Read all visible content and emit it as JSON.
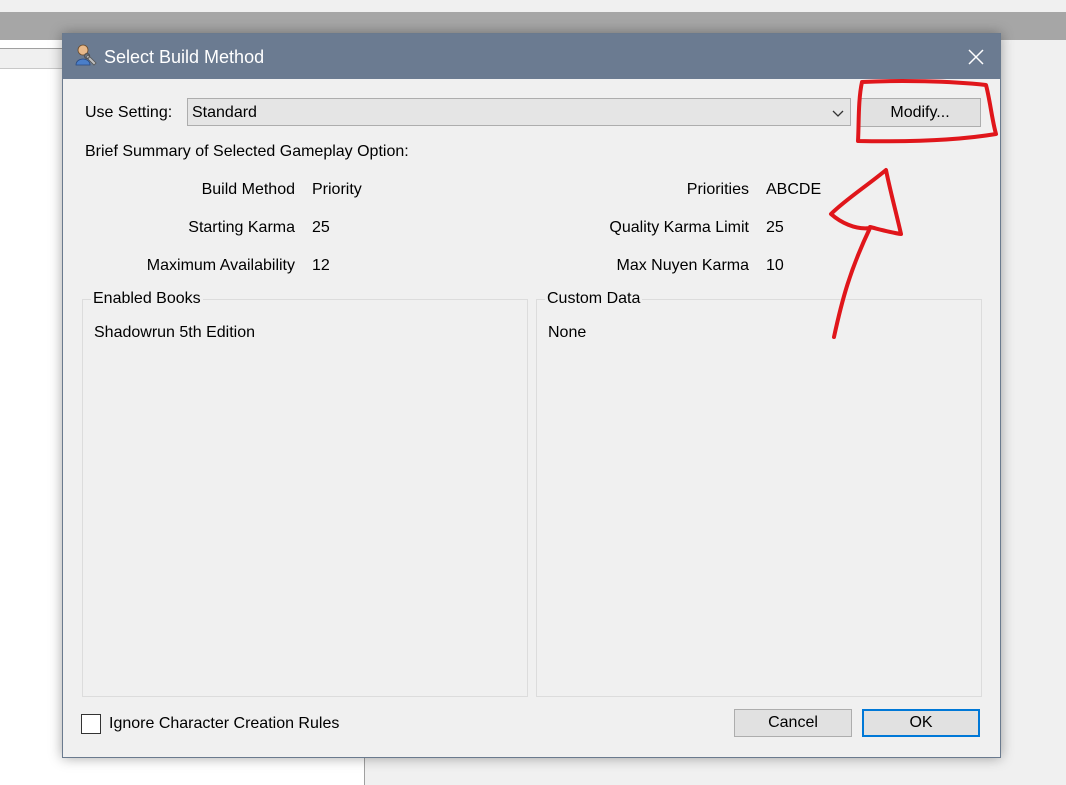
{
  "dialog": {
    "title": "Select Build Method",
    "use_setting_label": "Use Setting:",
    "use_setting_value": "Standard",
    "modify_label": "Modify...",
    "summary_label": "Brief Summary of Selected Gameplay Option:"
  },
  "summary": {
    "left": [
      {
        "label": "Build Method",
        "value": "Priority"
      },
      {
        "label": "Starting Karma",
        "value": "25"
      },
      {
        "label": "Maximum Availability",
        "value": "12"
      }
    ],
    "right": [
      {
        "label": "Priorities",
        "value": "ABCDE"
      },
      {
        "label": "Quality Karma Limit",
        "value": "25"
      },
      {
        "label": "Max Nuyen Karma",
        "value": "10"
      }
    ]
  },
  "groups": {
    "books_title": "Enabled Books",
    "books_items": [
      "Shadowrun 5th Edition"
    ],
    "custom_title": "Custom Data",
    "custom_items": [
      "None"
    ]
  },
  "footer": {
    "ignore_rules_label": "Ignore Character Creation Rules",
    "ignore_rules_checked": false,
    "cancel_label": "Cancel",
    "ok_label": "OK"
  },
  "colors": {
    "titlebar": "#6b7b91",
    "annotation": "#e0161b",
    "ok_border": "#0078d7"
  },
  "icons": {
    "title": "user-wrench-icon",
    "close": "close-icon",
    "dropdown": "chevron-down-icon"
  }
}
